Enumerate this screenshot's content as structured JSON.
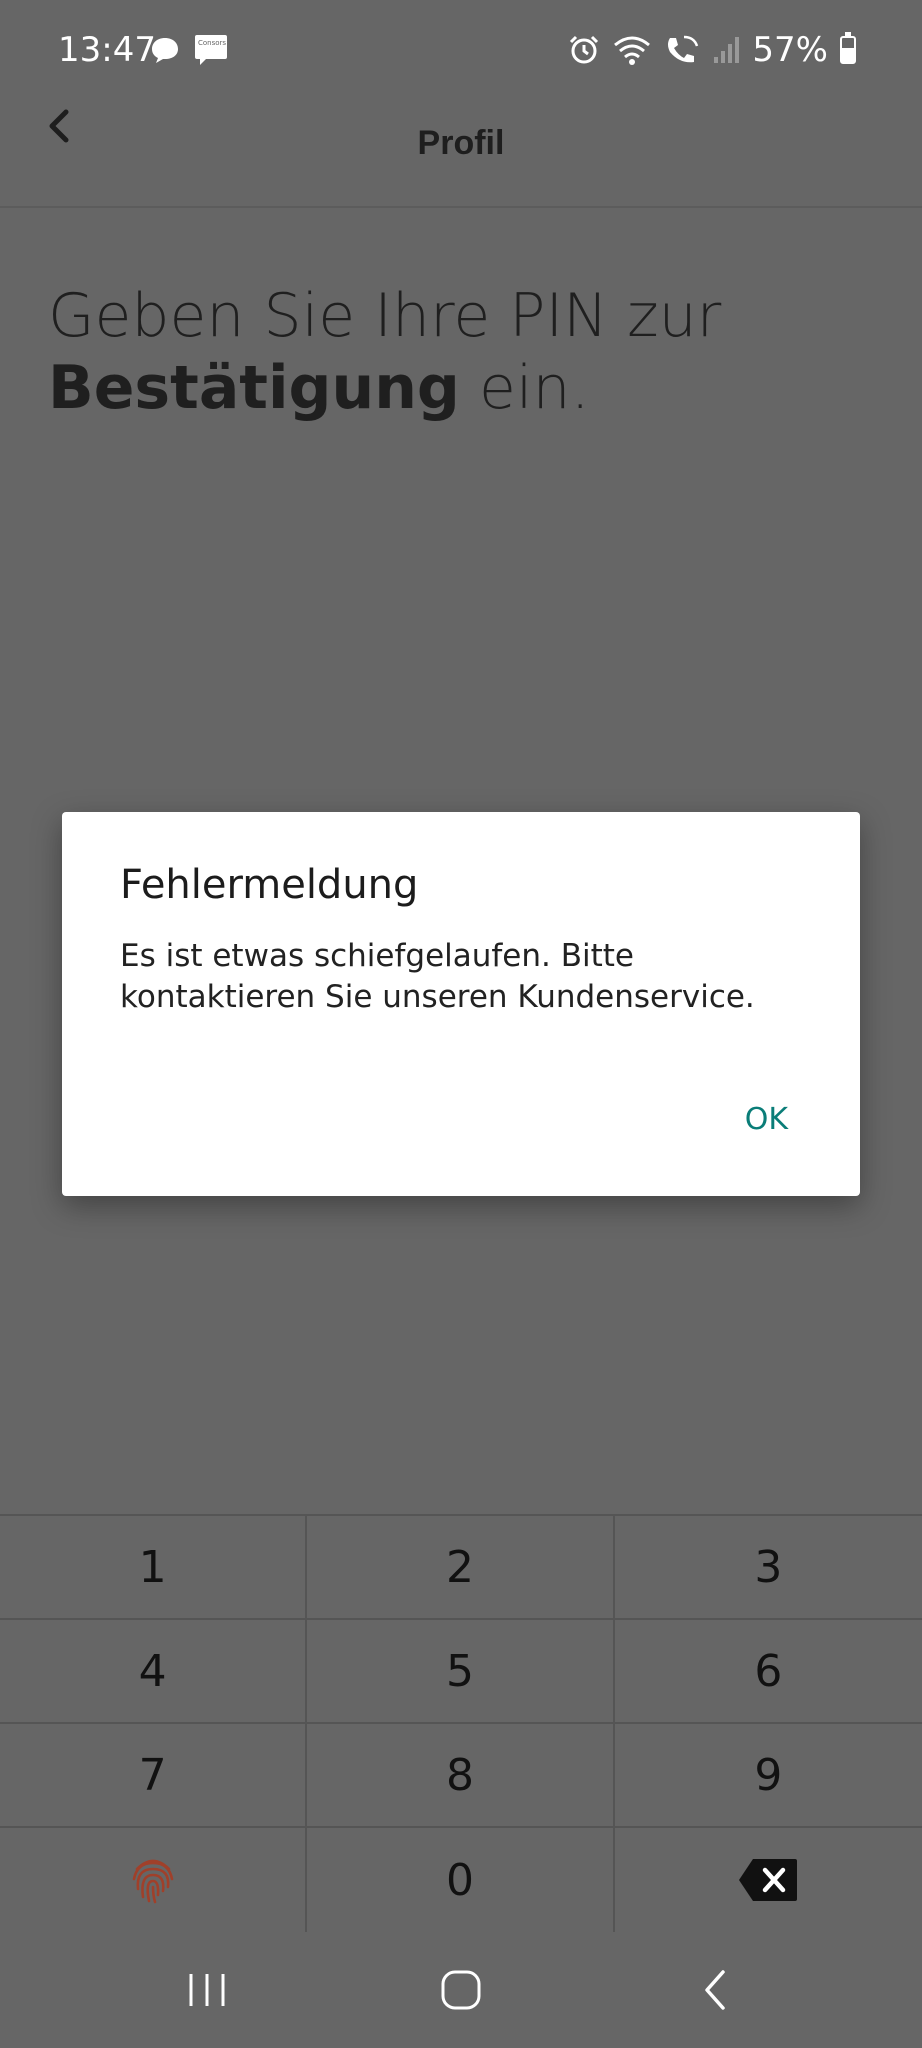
{
  "status_bar": {
    "time": "13:47",
    "battery_percent": "57%",
    "battery_level": 0.57,
    "notification_badge": "Consors bank"
  },
  "header": {
    "title": "Profil"
  },
  "prompt": {
    "text_normal_1": "Geben Sie Ihre PIN zur",
    "text_bold": "Bestätigung",
    "text_normal_2": " ein."
  },
  "dialog": {
    "title": "Fehlermeldung",
    "message": "Es ist etwas schiefgelaufen. Bitte kontaktieren Sie unseren Kundenservice.",
    "ok_label": "OK"
  },
  "keypad": {
    "keys": [
      "1",
      "2",
      "3",
      "4",
      "5",
      "6",
      "7",
      "8",
      "9",
      "",
      "0",
      ""
    ]
  },
  "colors": {
    "background": "#666666",
    "accent": "#0a7d78",
    "fingerprint": "#a0402a"
  }
}
